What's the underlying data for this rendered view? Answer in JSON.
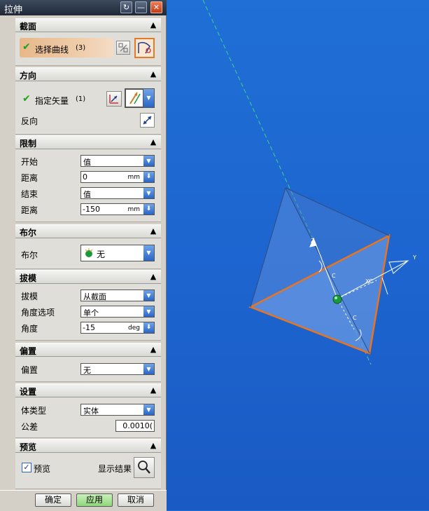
{
  "dialog": {
    "title": "拉伸",
    "title_buttons": {
      "reset": "↻",
      "minimize": "—",
      "close": "✕"
    }
  },
  "sections": {
    "section": {
      "title": "截面",
      "select_curve": "选择曲线",
      "select_curve_count": "(3)"
    },
    "direction": {
      "title": "方向",
      "specify_vector": "指定矢量",
      "specify_vector_count": "(1)",
      "reverse": "反向"
    },
    "limits": {
      "title": "限制",
      "start_label": "开始",
      "start_value": "值",
      "start_distance_label": "距离",
      "start_distance": "0",
      "start_unit": "mm",
      "end_label": "结束",
      "end_value": "值",
      "end_distance_label": "距离",
      "end_distance": "-150",
      "end_unit": "mm"
    },
    "boolean": {
      "title": "布尔",
      "label": "布尔",
      "value": "无"
    },
    "draft": {
      "title": "拔模",
      "draft_label": "拔模",
      "draft_value": "从截面",
      "angle_option_label": "角度选项",
      "angle_option_value": "单个",
      "angle_label": "角度",
      "angle_value": "-15",
      "angle_unit": "deg"
    },
    "offset": {
      "title": "偏置",
      "label": "偏置",
      "value": "无"
    },
    "settings": {
      "title": "设置",
      "body_type_label": "体类型",
      "body_type_value": "实体",
      "tolerance_label": "公差",
      "tolerance_value": "0.0010("
    },
    "preview": {
      "title": "预览",
      "preview_label": "预览",
      "preview_checked": true,
      "show_result_label": "显示结果"
    }
  },
  "footer": {
    "ok": "确定",
    "apply": "应用",
    "cancel": "取消"
  },
  "viewport": {
    "axis_labels": {
      "z": "Z",
      "y": "Y",
      "xc": "XC",
      "c1": "C",
      "c2": "C"
    },
    "colors": {
      "edge": "#e8741f",
      "face": "#5c8fd6",
      "point": "#1b9a3d"
    }
  }
}
